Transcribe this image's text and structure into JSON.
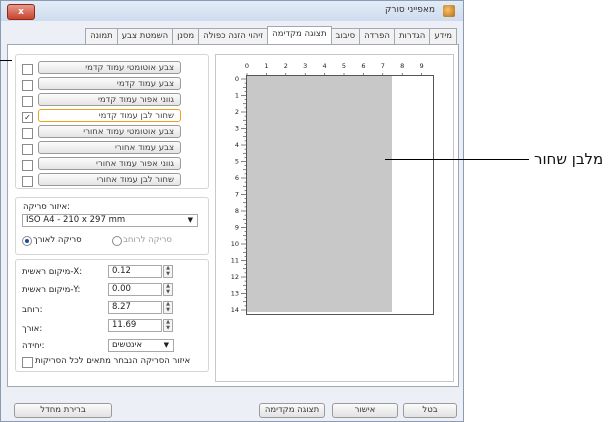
{
  "window": {
    "title": "מאפייני סורק",
    "close_label": "x"
  },
  "tabs": [
    "מידע",
    "הגדרות",
    "הפרדה",
    "סיבוב",
    "תצוגה מקדימה",
    "זיהוי הזנה כפולה",
    "מסנן",
    "השמטת צבע",
    "תמונה"
  ],
  "active_tab": "תצוגה מקדימה",
  "image_options": [
    {
      "label": "צבע אוטומטי עמוד קדמי",
      "checked": false
    },
    {
      "label": "צבע עמוד קדמי",
      "checked": false
    },
    {
      "label": "גווני אפור עמוד קדמי",
      "checked": false
    },
    {
      "label": "שחור לבן עמוד קדמי",
      "checked": true
    },
    {
      "label": "צבע אוטומטי עמוד אחורי",
      "checked": false
    },
    {
      "label": "צבע עמוד אחורי",
      "checked": false
    },
    {
      "label": "גווני אפור עמוד אחורי",
      "checked": false
    },
    {
      "label": "שחור לבן עמוד אחורי",
      "checked": false
    }
  ],
  "scan_area": {
    "label": "איזור סריקה:",
    "value": "ISO A4 - 210 x 297 mm",
    "radio_portrait": "סריקה לאורך",
    "radio_landscape": "סריקה לרוחב"
  },
  "fields": [
    {
      "label": "מיקום ראשית-X:",
      "value": "0.12"
    },
    {
      "label": "מיקום ראשית-Y:",
      "value": "0.00"
    },
    {
      "label": "רוחב:",
      "value": "8.27"
    },
    {
      "label": "אורך:",
      "value": "11.69"
    }
  ],
  "unit": {
    "label": "יחידה:",
    "value": "אינטשים"
  },
  "auto_fit_label": "איזור הסריקה הנבחר מתאים לכל הסריקות",
  "ruler": {
    "top": [
      "0",
      "1",
      "2",
      "3",
      "4",
      "5",
      "6",
      "7",
      "8",
      "9"
    ],
    "left": [
      "0",
      "1",
      "2",
      "3",
      "4",
      "5",
      "6",
      "7",
      "8",
      "9",
      "10",
      "11",
      "12",
      "13",
      "14"
    ]
  },
  "buttons": {
    "defaults": "ברירת מחדל",
    "preview": "תצוגה מקדימה",
    "ok": "אישור",
    "cancel": "בטל"
  },
  "callout": "מלבן שחור"
}
